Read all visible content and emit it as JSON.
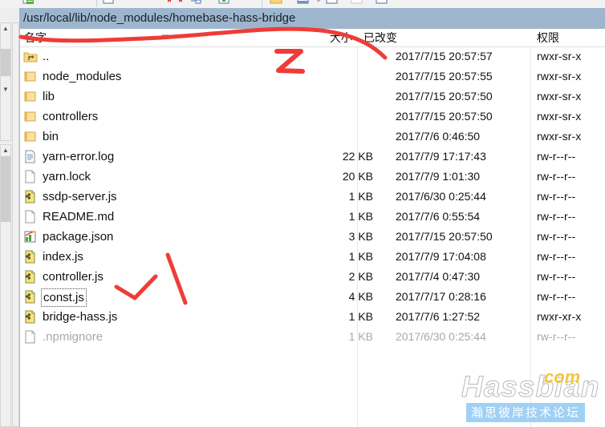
{
  "window": {
    "path": "/usr/local/lib/node_modules/homebase-hass-bridge"
  },
  "toolbar": {
    "icons": [
      "new-folder-icon",
      "open-icon",
      "bookmark-red-icon",
      "bookmark-red-2-icon",
      "transfer-icon",
      "add-green-icon",
      "folder-yellow-icon",
      "blue-window-icon",
      "blue-box-icon",
      "grey-box-icon",
      "blue-box-2-icon"
    ]
  },
  "columns": {
    "name": "名字",
    "size": "大小",
    "modified": "已改变",
    "permissions": "权限"
  },
  "files": [
    {
      "icon": "parent-folder-icon",
      "name": "..",
      "size": "",
      "modified": "2017/7/15 20:57:57",
      "permissions": "rwxr-sr-x",
      "dim": false,
      "focused": false
    },
    {
      "icon": "folder-icon",
      "name": "node_modules",
      "size": "",
      "modified": "2017/7/15 20:57:55",
      "permissions": "rwxr-sr-x",
      "dim": false,
      "focused": false
    },
    {
      "icon": "folder-icon",
      "name": "lib",
      "size": "",
      "modified": "2017/7/15 20:57:50",
      "permissions": "rwxr-sr-x",
      "dim": false,
      "focused": false
    },
    {
      "icon": "folder-icon",
      "name": "controllers",
      "size": "",
      "modified": "2017/7/15 20:57:50",
      "permissions": "rwxr-sr-x",
      "dim": false,
      "focused": false
    },
    {
      "icon": "folder-icon",
      "name": "bin",
      "size": "",
      "modified": "2017/7/6 0:46:50",
      "permissions": "rwxr-sr-x",
      "dim": false,
      "focused": false
    },
    {
      "icon": "log-file-icon",
      "name": "yarn-error.log",
      "size": "22 KB",
      "modified": "2017/7/9 17:17:43",
      "permissions": "rw-r--r--",
      "dim": false,
      "focused": false
    },
    {
      "icon": "blank-file-icon",
      "name": "yarn.lock",
      "size": "20 KB",
      "modified": "2017/7/9 1:01:30",
      "permissions": "rw-r--r--",
      "dim": false,
      "focused": false
    },
    {
      "icon": "js-file-icon",
      "name": "ssdp-server.js",
      "size": "1 KB",
      "modified": "2017/6/30 0:25:44",
      "permissions": "rw-r--r--",
      "dim": false,
      "focused": false
    },
    {
      "icon": "blank-file-icon",
      "name": "README.md",
      "size": "1 KB",
      "modified": "2017/7/6 0:55:54",
      "permissions": "rw-r--r--",
      "dim": false,
      "focused": false
    },
    {
      "icon": "json-file-icon",
      "name": "package.json",
      "size": "3 KB",
      "modified": "2017/7/15 20:57:50",
      "permissions": "rw-r--r--",
      "dim": false,
      "focused": false
    },
    {
      "icon": "js-file-icon",
      "name": "index.js",
      "size": "1 KB",
      "modified": "2017/7/9 17:04:08",
      "permissions": "rw-r--r--",
      "dim": false,
      "focused": false
    },
    {
      "icon": "js-file-icon",
      "name": "controller.js",
      "size": "2 KB",
      "modified": "2017/7/4 0:47:30",
      "permissions": "rw-r--r--",
      "dim": false,
      "focused": false
    },
    {
      "icon": "js-file-icon",
      "name": "const.js",
      "size": "4 KB",
      "modified": "2017/7/17 0:28:16",
      "permissions": "rw-r--r--",
      "dim": false,
      "focused": true
    },
    {
      "icon": "js-file-icon",
      "name": "bridge-hass.js",
      "size": "1 KB",
      "modified": "2017/7/6 1:27:52",
      "permissions": "rwxr-xr-x",
      "dim": false,
      "focused": false
    },
    {
      "icon": "blank-file-icon",
      "name": ".npmignore",
      "size": "1 KB",
      "modified": "2017/6/30 0:25:44",
      "permissions": "rw-r--r--",
      "dim": true,
      "focused": false
    }
  ],
  "annotations": {
    "color": "#ef3c36",
    "marks": [
      "underline-stroke-name-to-size",
      "letter-Z",
      "check-stroke-near-const-js",
      "slash-stroke"
    ],
    "letter_z": "Z"
  },
  "watermark": {
    "main": "Hassbian",
    "tld": "com",
    "subtitle": "瀚思彼岸技术论坛"
  }
}
